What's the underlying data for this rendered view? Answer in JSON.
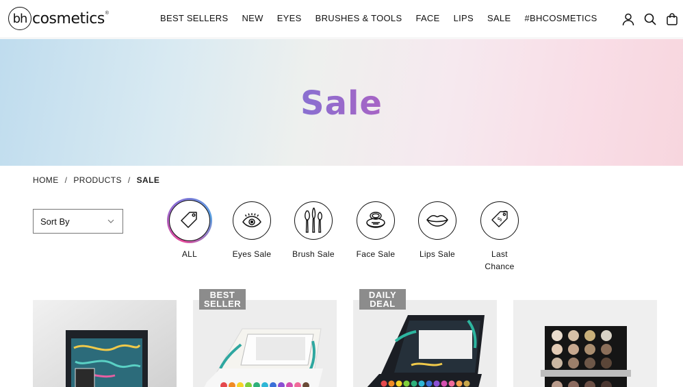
{
  "logo": {
    "mark": "bh",
    "word": "cosmetics",
    "reg": "®"
  },
  "nav": [
    "BEST SELLERS",
    "NEW",
    "EYES",
    "BRUSHES & TOOLS",
    "FACE",
    "LIPS",
    "SALE",
    "#BHCOSMETICS"
  ],
  "header_icons": [
    "account-icon",
    "search-icon",
    "bag-icon"
  ],
  "hero": {
    "title": "Sale"
  },
  "breadcrumb": {
    "home": "HOME",
    "sep": "/",
    "products": "PRODUCTS",
    "current": "SALE"
  },
  "sort": {
    "label": "Sort By"
  },
  "categories": [
    {
      "label": "ALL",
      "icon": "price-tag-icon",
      "active": true
    },
    {
      "label": "Eyes Sale",
      "icon": "eye-icon"
    },
    {
      "label": "Brush Sale",
      "icon": "brushes-icon"
    },
    {
      "label": "Face Sale",
      "icon": "compact-icon"
    },
    {
      "label": "Lips Sale",
      "icon": "lips-icon"
    },
    {
      "label": "Last Chance",
      "icon": "dollar-tag-icon"
    }
  ],
  "products": [
    {
      "badge": ""
    },
    {
      "badge_line1": "BEST",
      "badge_line2": "SELLER"
    },
    {
      "badge_line1": "DAILY",
      "badge_line2": "DEAL"
    },
    {
      "badge": ""
    }
  ],
  "colors": {
    "hero_gradient_start": "#bfdcee",
    "hero_gradient_end": "#f7d6de",
    "title_gradient_start": "#5b9bd9",
    "title_gradient_end": "#ee3e8d",
    "badge_bg": "#8c8c8c"
  }
}
